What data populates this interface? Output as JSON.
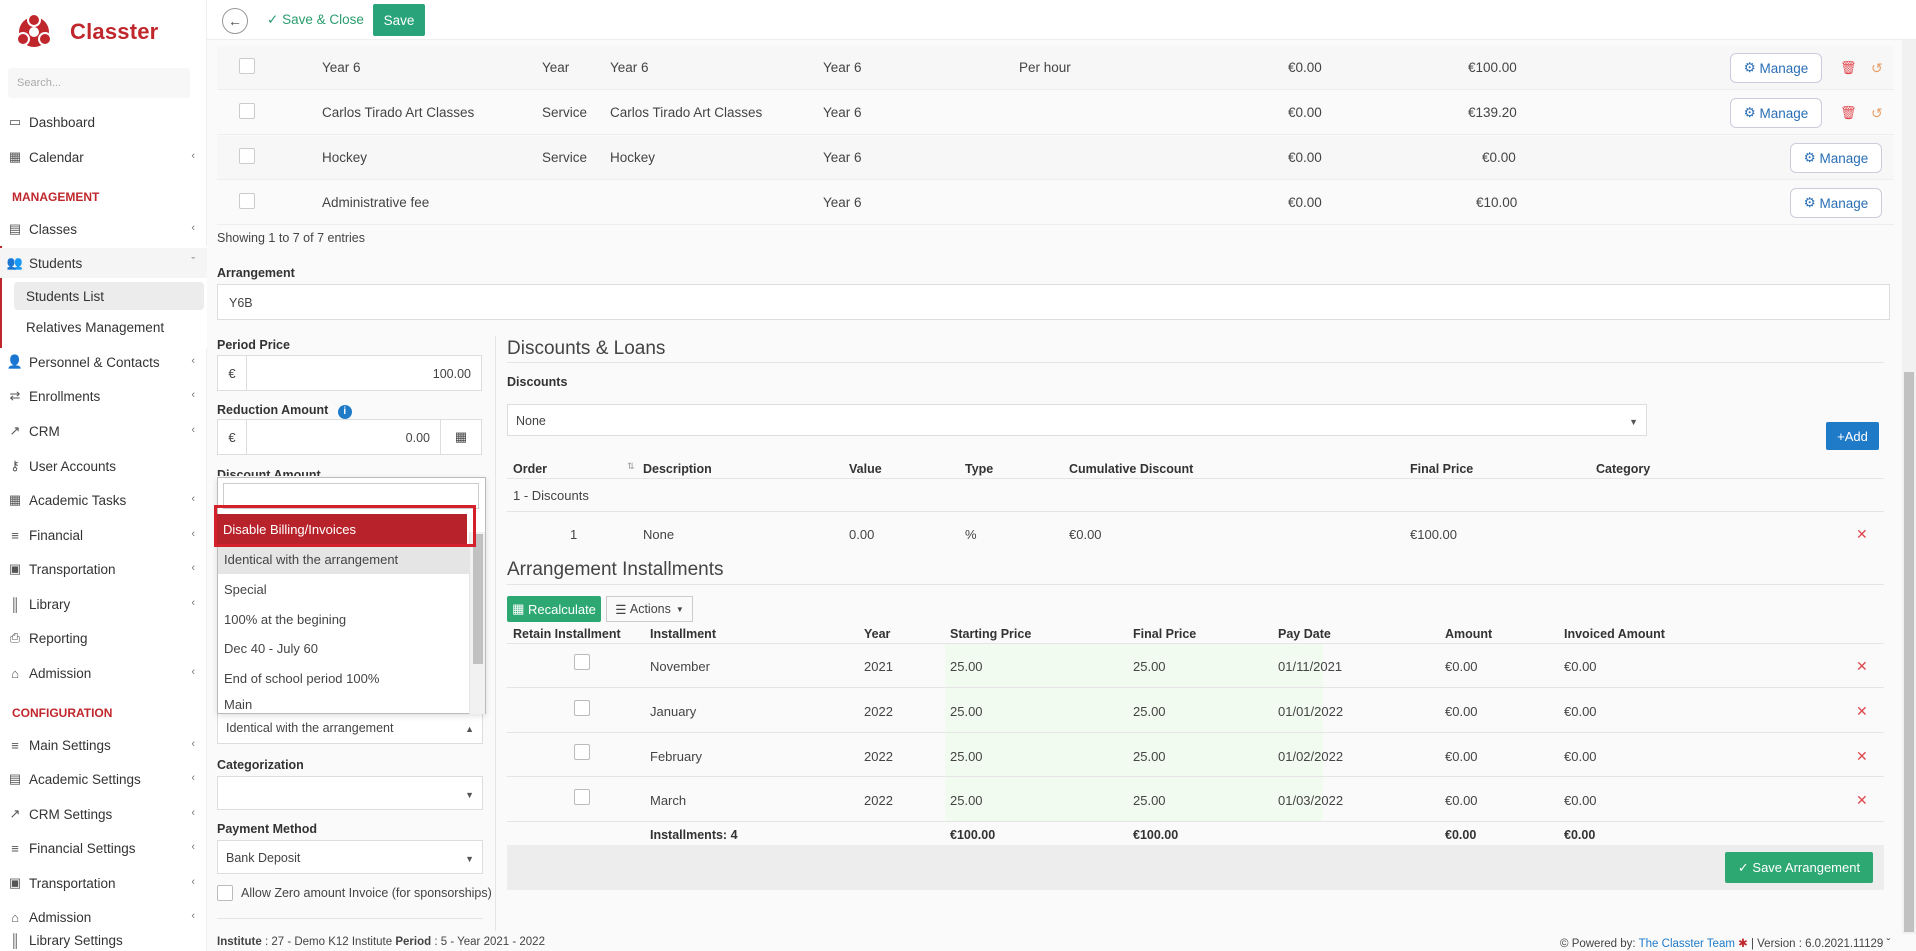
{
  "app": {
    "name": "Classter",
    "search_placeholder": "Search..."
  },
  "sidebar": {
    "items": [
      {
        "label": "Dashboard"
      },
      {
        "label": "Calendar"
      },
      {
        "label": "Classes"
      },
      {
        "label": "Students"
      },
      {
        "label": "Personnel & Contacts"
      },
      {
        "label": "Enrollments"
      },
      {
        "label": "CRM"
      },
      {
        "label": "User Accounts"
      },
      {
        "label": "Academic Tasks"
      },
      {
        "label": "Financial"
      },
      {
        "label": "Transportation"
      },
      {
        "label": "Library"
      },
      {
        "label": "Reporting"
      },
      {
        "label": "Admission"
      },
      {
        "label": "Main Settings"
      },
      {
        "label": "Academic Settings"
      },
      {
        "label": "CRM Settings"
      },
      {
        "label": "Financial Settings"
      },
      {
        "label": "Transportation"
      },
      {
        "label": "Admission"
      },
      {
        "label": "Library Settings"
      }
    ],
    "sections": {
      "management": "MANAGEMENT",
      "configuration": "CONFIGURATION"
    },
    "sub_items": {
      "students_list": "Students List",
      "relatives": "Relatives Management"
    }
  },
  "topbar": {
    "save_close": "Save & Close",
    "save": "Save"
  },
  "services_table": {
    "rows": [
      {
        "name": "Year 6",
        "type": "Year",
        "desc": "Year 6",
        "level": "Year 6",
        "unit": "Per hour",
        "a": "€0.00",
        "b": "€100.00"
      },
      {
        "name": "Carlos Tirado Art Classes",
        "type": "Service",
        "desc": "Carlos Tirado Art Classes",
        "level": "Year 6",
        "unit": "",
        "a": "€0.00",
        "b": "€139.20"
      },
      {
        "name": "Hockey",
        "type": "Service",
        "desc": "Hockey",
        "level": "Year 6",
        "unit": "",
        "a": "€0.00",
        "b": "€0.00"
      },
      {
        "name": "Administrative fee",
        "type": "",
        "desc": "",
        "level": "Year 6",
        "unit": "",
        "a": "€0.00",
        "b": "€10.00"
      }
    ],
    "manage_label": "Manage",
    "showing": "Showing 1 to 7 of 7 entries"
  },
  "form": {
    "arrangement_label": "Arrangement",
    "arrangement_value": "Y6B",
    "period_price_label": "Period Price",
    "currency": "€",
    "period_price_value": "100.00",
    "reduction_label": "Reduction Amount",
    "reduction_value": "0.00",
    "discount_amount_label": "Discount Amount",
    "billing_select_value": "Identical with the arrangement",
    "categorization_label": "Categorization",
    "payment_method_label": "Payment Method",
    "payment_method_value": "Bank Deposit",
    "allow_zero_label": "Allow Zero amount Invoice (for sponsorships)"
  },
  "dropdown": {
    "options": [
      "Disable Billing/Invoices",
      "Identical with the arrangement",
      "Special",
      "100% at the begining",
      "Dec 40 - July 60",
      "End of school period 100%",
      "Main"
    ]
  },
  "discounts": {
    "title": "Discounts & Loans",
    "discounts_label": "Discounts",
    "select_value": "None",
    "add_label": "Add",
    "headers": [
      "Order",
      "Description",
      "Value",
      "Type",
      "Cumulative Discount",
      "Final Price",
      "Category"
    ],
    "group_label": "1 - Discounts",
    "row": {
      "order": "1",
      "description": "None",
      "value": "0.00",
      "type": "%",
      "cumulative": "€0.00",
      "final": "€100.00"
    }
  },
  "installments": {
    "title": "Arrangement Installments",
    "recalculate_label": "Recalculate",
    "actions_label": "Actions",
    "headers": [
      "Retain Installment",
      "Installment",
      "Year",
      "Starting Price",
      "Final Price",
      "Pay Date",
      "Amount",
      "Invoiced Amount"
    ],
    "rows": [
      {
        "installment": "November",
        "year": "2021",
        "start": "25.00",
        "final": "25.00",
        "date": "01/11/2021",
        "amount": "€0.00",
        "invoiced": "€0.00"
      },
      {
        "installment": "January",
        "year": "2022",
        "start": "25.00",
        "final": "25.00",
        "date": "01/01/2022",
        "amount": "€0.00",
        "invoiced": "€0.00"
      },
      {
        "installment": "February",
        "year": "2022",
        "start": "25.00",
        "final": "25.00",
        "date": "01/02/2022",
        "amount": "€0.00",
        "invoiced": "€0.00"
      },
      {
        "installment": "March",
        "year": "2022",
        "start": "25.00",
        "final": "25.00",
        "date": "01/03/2022",
        "amount": "€0.00",
        "invoiced": "€0.00"
      }
    ],
    "totals": {
      "count": "Installments: 4",
      "start": "€100.00",
      "final": "€100.00",
      "amount": "€0.00",
      "invoiced": "€0.00"
    },
    "save_label": "Save Arrangement"
  },
  "footer": {
    "institute_key": "Institute",
    "institute_value": ": 27 - Demo K12 Institute",
    "period_key": "Period",
    "period_value": ": 5 - Year 2021 - 2022",
    "powered_by": "Powered by:",
    "team": "The Classter Team",
    "version": "| Version : 6.0.2021.11129"
  },
  "colors": {
    "brand": "#c0272d",
    "primary": "#1f7ac8",
    "success": "#2ea873",
    "danger": "#e0484f"
  }
}
